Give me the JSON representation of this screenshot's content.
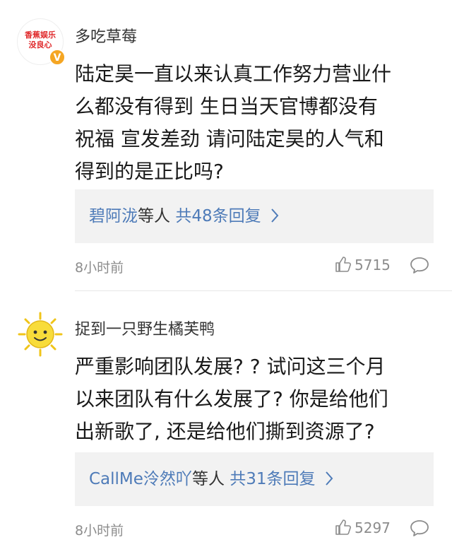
{
  "comments": [
    {
      "avatar_text": "香蕉娱乐\n没良心",
      "verified_badge": "V",
      "username": "多吃草莓",
      "body": "陆定昊一直以来认真工作努力营业什\n么都没有得到 生日当天官博都没有\n祝福 宣发差劲 请问陆定昊的人气和\n得到的是正比吗?",
      "reply_user": "碧阿泷",
      "reply_mid": "等人 ",
      "reply_count": "共48条回复",
      "time": "8小时前",
      "likes": "5715"
    },
    {
      "avatar_icon": "sun-icon",
      "username": "捉到一只野生橘芙鸭",
      "body": "严重影响团队发展? ? 试问这三个月\n以来团队有什么发展了? 你是给他们\n出新歌了, 还是给他们撕到资源了?",
      "reply_user": "CallMe泠然吖",
      "reply_mid": "等人 ",
      "reply_count": "共31条回复",
      "time": "8小时前",
      "likes": "5297"
    }
  ],
  "colors": {
    "link": "#4e7bb8",
    "muted": "#8c8c8c",
    "reply_bg": "#f2f2f2",
    "badge": "#f5a623",
    "avatar_text": "#e0292b"
  },
  "icons": [
    "thumbs-up-icon",
    "comment-bubble-icon",
    "chevron-right-icon"
  ]
}
